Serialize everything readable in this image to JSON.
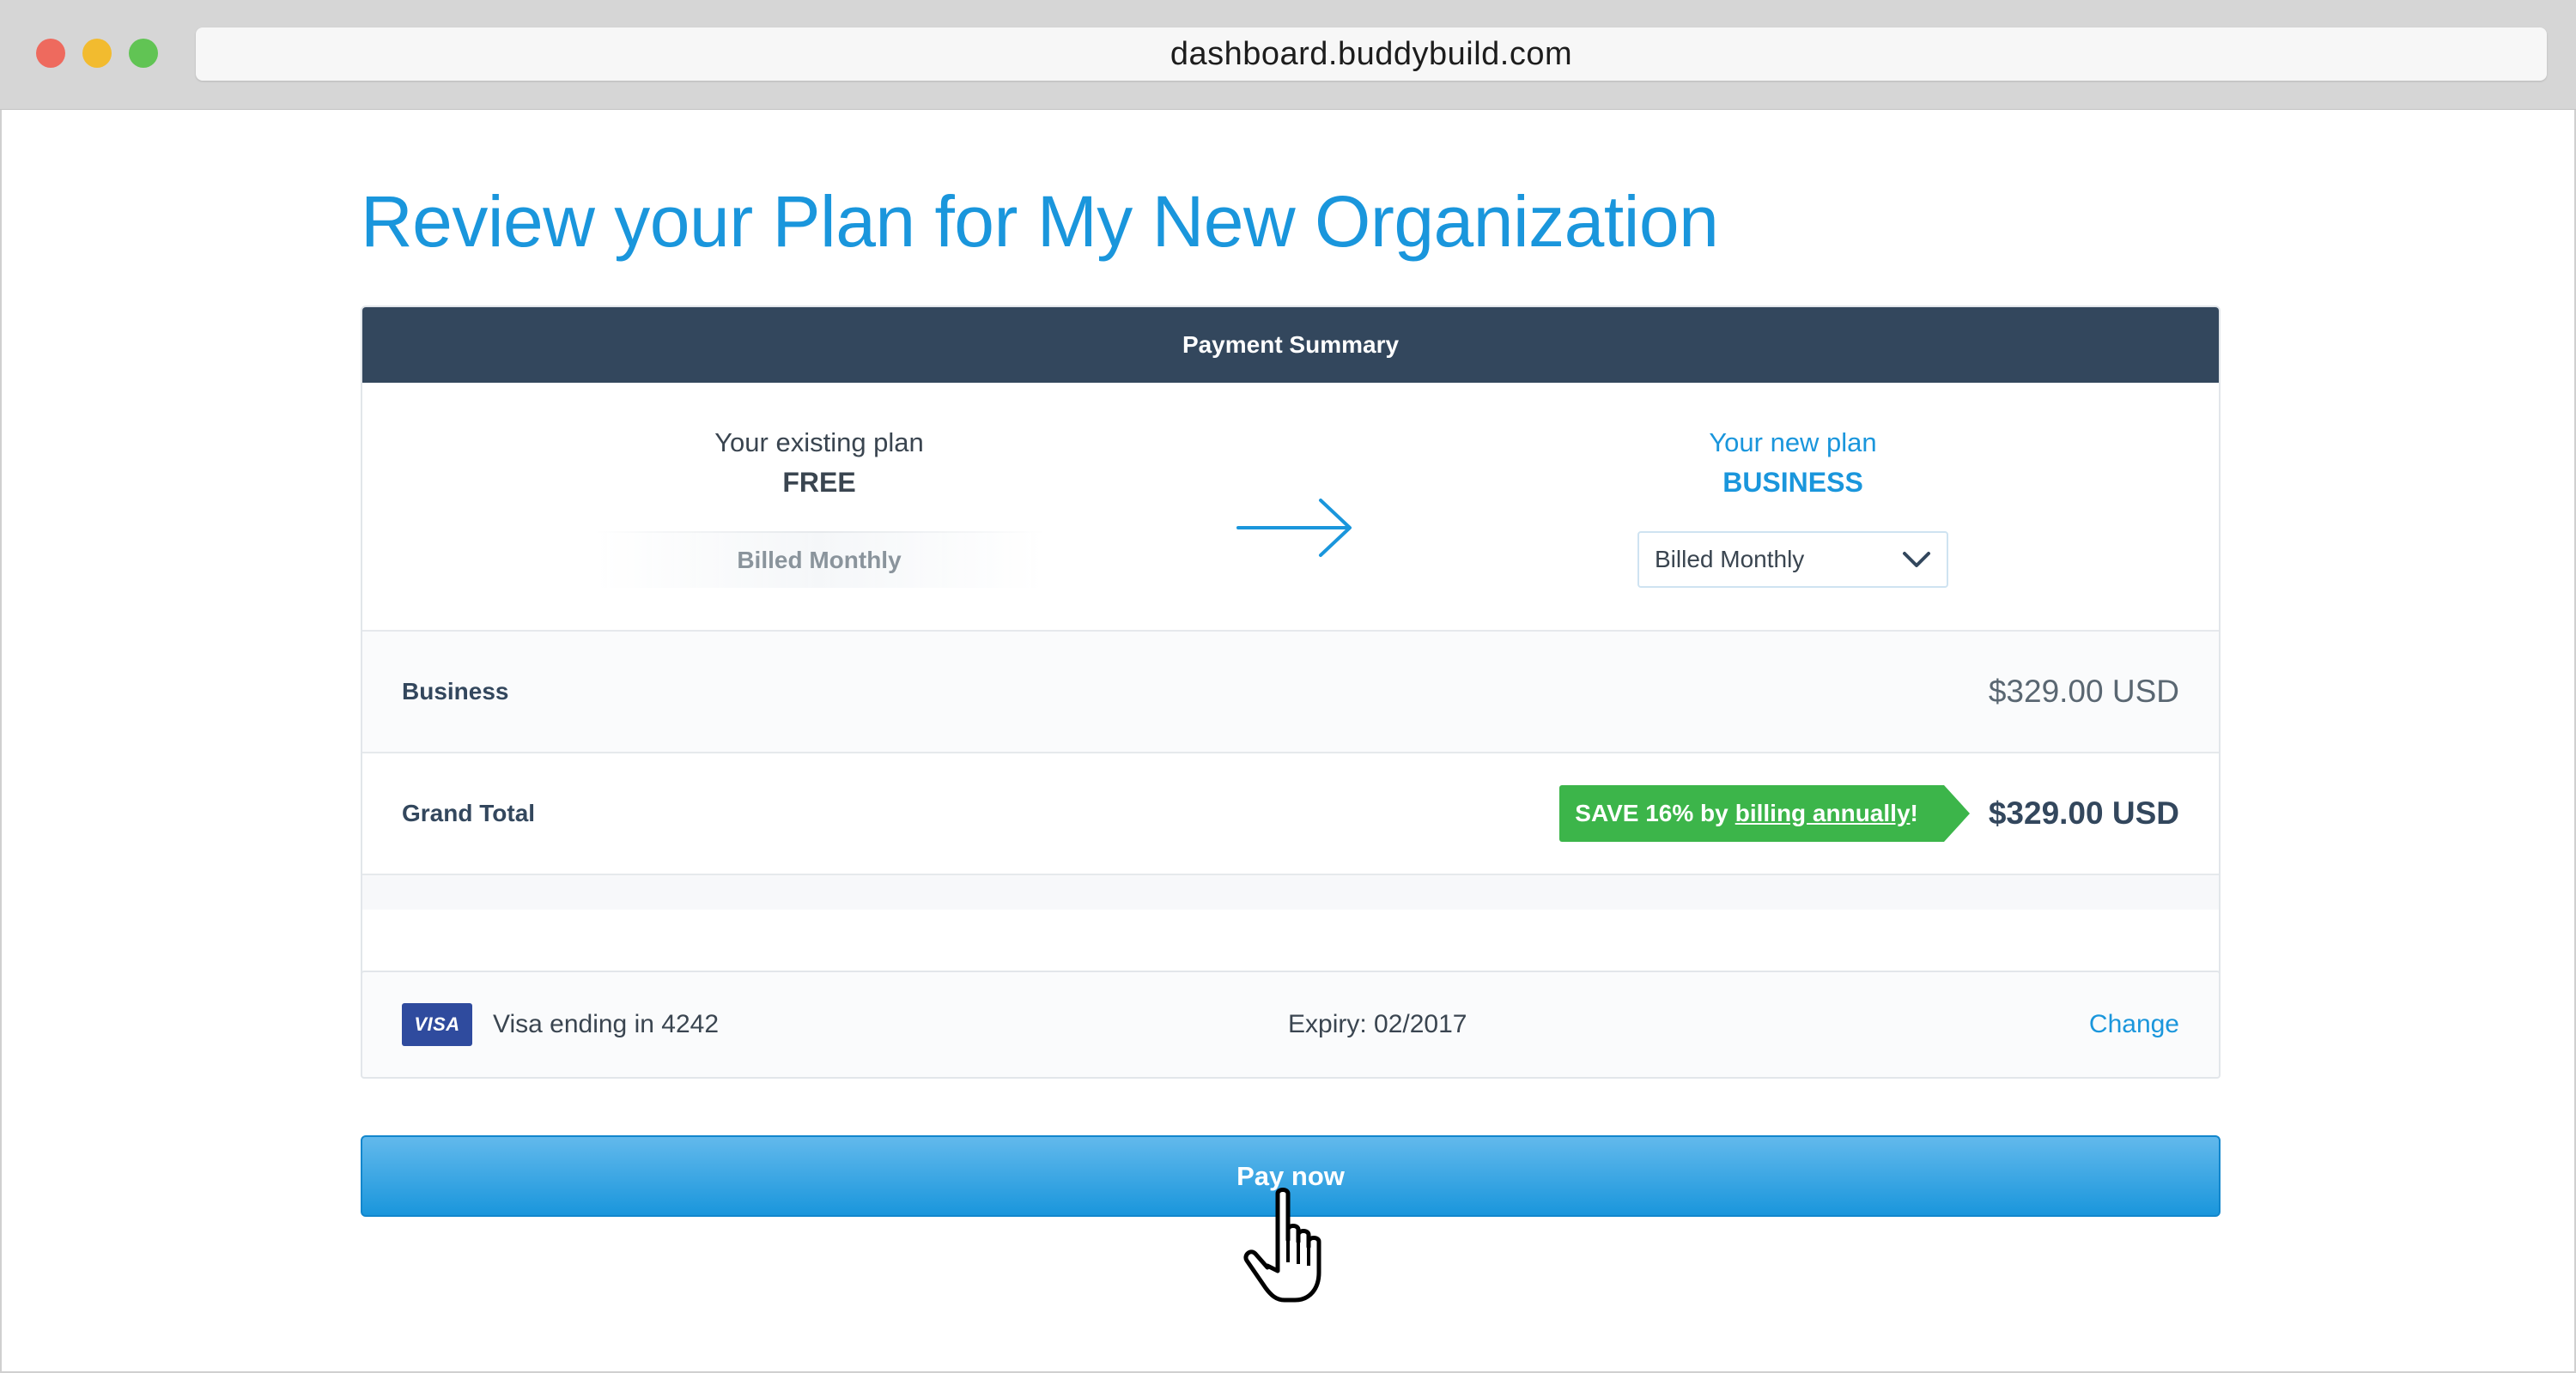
{
  "browser": {
    "url": "dashboard.buddybuild.com"
  },
  "page": {
    "title": "Review your Plan for My New Organization"
  },
  "summary": {
    "header": "Payment Summary",
    "existing_plan": {
      "caption": "Your existing plan",
      "name": "FREE",
      "billing": "Billed Monthly"
    },
    "new_plan": {
      "caption": "Your new plan",
      "name": "BUSINESS",
      "billing_select": "Billed Monthly"
    },
    "line_item": {
      "label": "Business",
      "amount": "$329.00 USD"
    },
    "grand_total": {
      "label": "Grand Total",
      "save_prefix": "SAVE 16% by",
      "save_link": "billing annually",
      "save_suffix": "!",
      "amount": "$329.00 USD"
    }
  },
  "payment_method": {
    "brand": "VISA",
    "label": "Visa ending in 4242",
    "expiry": "Expiry: 02/2017",
    "change_label": "Change"
  },
  "actions": {
    "pay_label": "Pay now"
  },
  "colors": {
    "accent": "#1a96dc",
    "header_bg": "#33475d",
    "save_green": "#3cb54a",
    "visa_blue": "#2f4b9e"
  }
}
